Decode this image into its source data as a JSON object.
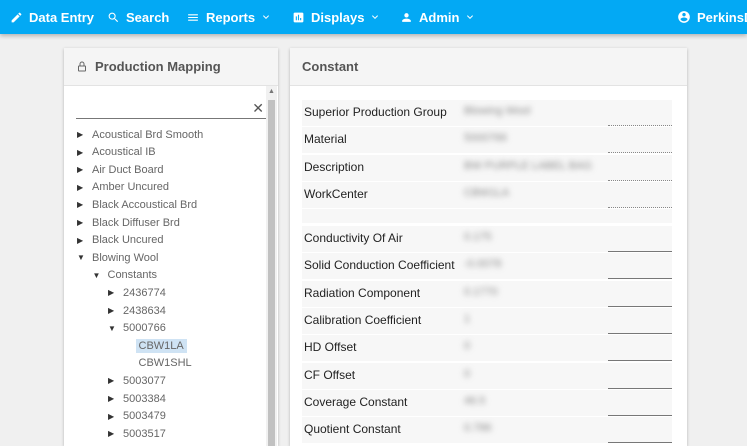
{
  "nav": {
    "data_entry": "Data Entry",
    "search": "Search",
    "reports": "Reports",
    "displays": "Displays",
    "admin": "Admin",
    "user": "PerkinsD"
  },
  "left_panel": {
    "title": "Production Mapping",
    "search_value": "",
    "clear_glyph": "✕",
    "tree": [
      {
        "label": "Acoustical Brd Smooth",
        "expanded": false
      },
      {
        "label": "Acoustical IB",
        "expanded": false
      },
      {
        "label": "Air Duct Board",
        "expanded": false
      },
      {
        "label": "Amber Uncured",
        "expanded": false
      },
      {
        "label": "Black Accoustical Brd",
        "expanded": false
      },
      {
        "label": "Black Diffuser Brd",
        "expanded": false
      },
      {
        "label": "Black Uncured",
        "expanded": false
      },
      {
        "label": "Blowing Wool",
        "expanded": true
      },
      {
        "label": "Constants",
        "expanded": true
      },
      {
        "label": "2436774",
        "expanded": false
      },
      {
        "label": "2438634",
        "expanded": false
      },
      {
        "label": "5000766",
        "expanded": true
      },
      {
        "label": "CBW1LA",
        "selected": true
      },
      {
        "label": "CBW1SHL"
      },
      {
        "label": "5003077",
        "expanded": false
      },
      {
        "label": "5003384",
        "expanded": false
      },
      {
        "label": "5003479",
        "expanded": false
      },
      {
        "label": "5003517",
        "expanded": false
      }
    ]
  },
  "right_panel": {
    "title": "Constant",
    "info_fields": [
      {
        "label": "Superior Production Group",
        "value": "Blowing Wool"
      },
      {
        "label": "Material",
        "value": "5000766"
      },
      {
        "label": "Description",
        "value": "BW PURPLE LABEL BAG"
      },
      {
        "label": "WorkCenter",
        "value": "CBW1LA"
      }
    ],
    "constant_fields": [
      {
        "label": "Conductivity Of Air",
        "value": "0.175"
      },
      {
        "label": "Solid Conduction Coefficient",
        "value": "-0.0078"
      },
      {
        "label": "Radiation Component",
        "value": "0.1770"
      },
      {
        "label": "Calibration Coefficient",
        "value": "1"
      },
      {
        "label": "HD Offset",
        "value": "0"
      },
      {
        "label": "CF Offset",
        "value": "0"
      },
      {
        "label": "Coverage Constant",
        "value": "46.5"
      },
      {
        "label": "Quotient Constant",
        "value": "0.786"
      }
    ]
  },
  "colors": {
    "topbar": "#03a9f4",
    "selected_bg": "#cfe3f4"
  }
}
